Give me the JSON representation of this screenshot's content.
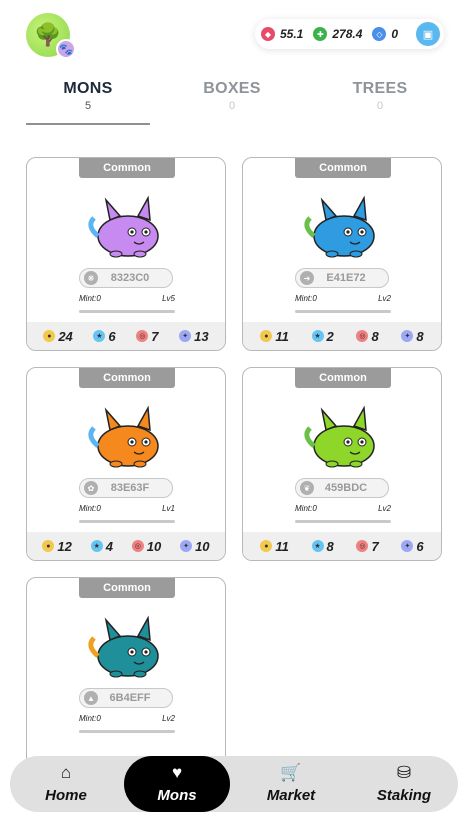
{
  "header": {
    "resources": [
      {
        "name": "gem-icon",
        "color": "#e84a6a",
        "value": "55.1"
      },
      {
        "name": "leaf-coin-icon",
        "color": "#3bb34a",
        "value": "278.4"
      },
      {
        "name": "drop-coin-icon",
        "color": "#4a8fe8",
        "value": "0"
      }
    ]
  },
  "tabs": [
    {
      "label": "MONS",
      "count": "5"
    },
    {
      "label": "BOXES",
      "count": "0"
    },
    {
      "label": "TREES",
      "count": "0"
    }
  ],
  "cards": [
    {
      "rarity": "Common",
      "id": "8323C0",
      "mint": "Mint:0",
      "level": "Lv5",
      "color": "#c78af0",
      "accent": "#5bb5f0",
      "stats": {
        "hp": "24",
        "speed": "6",
        "skill": "7",
        "morale": "13"
      }
    },
    {
      "rarity": "Common",
      "id": "E41E72",
      "mint": "Mint:0",
      "level": "Lv2",
      "color": "#2f9be0",
      "accent": "#6cc04a",
      "stats": {
        "hp": "11",
        "speed": "2",
        "skill": "8",
        "morale": "8"
      }
    },
    {
      "rarity": "Common",
      "id": "83E63F",
      "mint": "Mint:0",
      "level": "Lv1",
      "color": "#f5891e",
      "accent": "#5bb5f0",
      "stats": {
        "hp": "12",
        "speed": "4",
        "skill": "10",
        "morale": "10"
      }
    },
    {
      "rarity": "Common",
      "id": "459BDC",
      "mint": "Mint:0",
      "level": "Lv2",
      "color": "#8ed62a",
      "accent": "#6cc04a",
      "stats": {
        "hp": "11",
        "speed": "8",
        "skill": "7",
        "morale": "6"
      }
    },
    {
      "rarity": "Common",
      "id": "6B4EFF",
      "mint": "Mint:0",
      "level": "Lv2",
      "color": "#1f8f9a",
      "accent": "#f0a020",
      "stats": {
        "hp": "",
        "speed": "",
        "skill": "",
        "morale": ""
      }
    }
  ],
  "nav": [
    {
      "label": "Home",
      "icon": "home-icon"
    },
    {
      "label": "Mons",
      "icon": "heart-icon"
    },
    {
      "label": "Market",
      "icon": "cart-icon"
    },
    {
      "label": "Staking",
      "icon": "coin-stack-icon"
    }
  ]
}
